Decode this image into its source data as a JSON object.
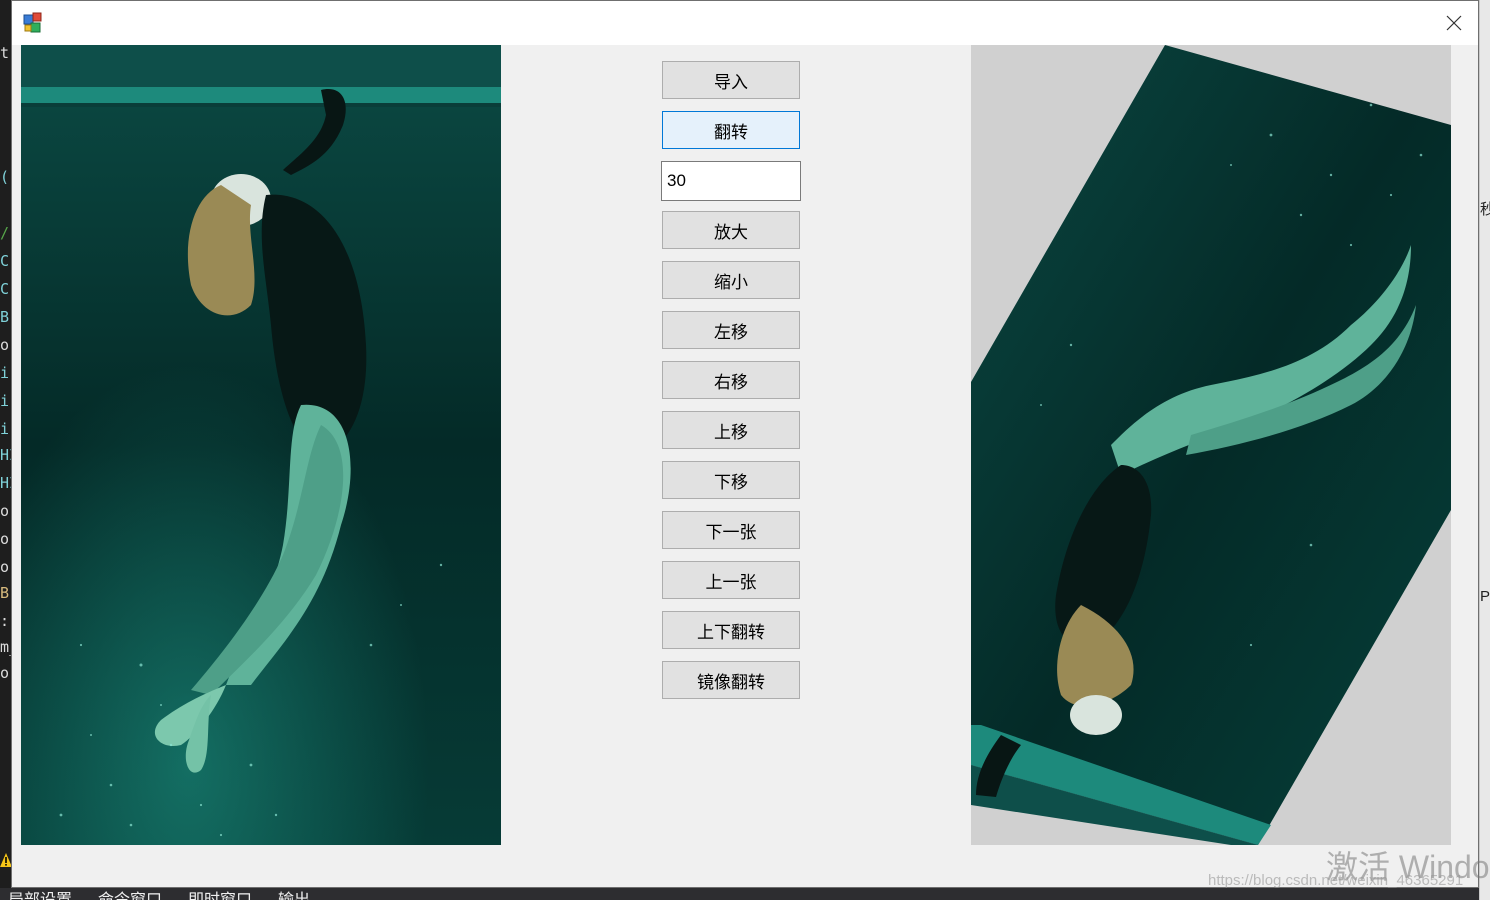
{
  "window": {
    "close_label": "×"
  },
  "toolbar": {
    "import_label": "导入",
    "flip_label": "翻转",
    "angle_value": "30",
    "zoom_in_label": "放大",
    "zoom_out_label": "缩小",
    "move_left_label": "左移",
    "move_right_label": "右移",
    "move_up_label": "上移",
    "move_down_label": "下移",
    "next_label": "下一张",
    "prev_label": "上一张",
    "vflip_label": "上下翻转",
    "mirror_label": "镜像翻转"
  },
  "images": {
    "left_icon": "original-photo-underwater-woman",
    "right_icon": "rotated-photo-underwater-woman",
    "rotation_degrees": 210
  },
  "ide_background": {
    "left_fragments": [
      "tr",
      "(",
      "/",
      "C:",
      "C:",
      "B",
      "or",
      "i",
      "i",
      "i",
      "HI",
      "HI",
      "or",
      "or",
      "or",
      "Br",
      ":",
      "m_",
      "or"
    ],
    "bottom_tabs": [
      "局部设置",
      "命令窗口",
      "即时窗口",
      "输出"
    ],
    "right_fragments": [
      "秒",
      "P"
    ]
  },
  "watermark": {
    "windows_text": "激活 Windo",
    "url_text": "https://blog.csdn.net/weixin_46365291"
  },
  "colors": {
    "accent": "#0078d7",
    "water_dark": "#052e2b",
    "water_teal": "#1f9b8a",
    "canvas_gray": "#d0d0d0"
  }
}
